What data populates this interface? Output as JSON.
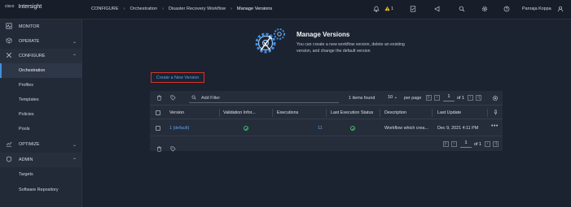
{
  "app": {
    "vendor": "cisco",
    "name": "Intersight"
  },
  "breadcrumb": [
    "CONFIGURE",
    "Orchestration",
    "Disaster Recovery Workflow",
    "Manage Versions"
  ],
  "topbar": {
    "alert_count": "1",
    "user_name": "Panraja Koppa"
  },
  "sidebar": {
    "monitor": "MONITOR",
    "operate": "OPERATE",
    "configure": "CONFIGURE",
    "configure_items": [
      "Orchestration",
      "Profiles",
      "Templates",
      "Policies",
      "Pools"
    ],
    "optimize": "OPTIMIZE",
    "admin": "ADMIN",
    "admin_items": [
      "Targets",
      "Software Repository"
    ],
    "active_item": "Orchestration"
  },
  "hero": {
    "title": "Manage Versions",
    "description": "You can create a new workflow version, delete an existing version, and change the default version"
  },
  "create_button": "Create a New Version",
  "table": {
    "filter_placeholder": "Add Filter",
    "items_found": "1 items found",
    "per_page_value": "10",
    "per_page_label": "per page",
    "page": "1",
    "of_pages": "of 1",
    "columns": [
      "Version",
      "Validation Infor...",
      "Executions",
      "Last Execution Status",
      "Description",
      "Last Update"
    ],
    "rows": [
      {
        "version": "1 (default)",
        "executions": "11",
        "description": "Workflow which crea...",
        "last_update": "Dec 9, 2021 4:11 PM"
      }
    ]
  },
  "colors": {
    "accent": "#3f8fe0",
    "link": "#5aa5ef",
    "highlight_border": "#d9342b",
    "success": "#47b36d",
    "warning": "#f2c12e"
  }
}
